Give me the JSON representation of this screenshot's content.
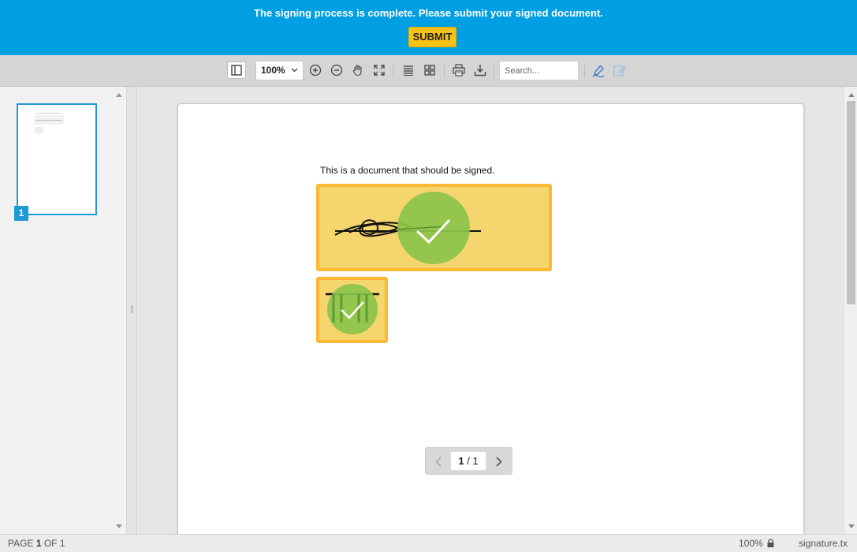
{
  "banner": {
    "message": "The signing process is complete. Please submit your signed document.",
    "submit_label": "SUBMIT"
  },
  "toolbar": {
    "zoom_value": "100%",
    "search_placeholder": "Search...",
    "icons": [
      "sidebar-toggle-icon",
      "zoom-in-icon",
      "zoom-out-icon",
      "pan-hand-icon",
      "fit-page-icon",
      "single-page-icon",
      "grid-view-icon",
      "print-icon",
      "download-icon",
      "signature-pen-icon",
      "edit-form-icon"
    ]
  },
  "sidebar": {
    "thumbnails": [
      {
        "number": "1"
      }
    ]
  },
  "document": {
    "text": "This is a document that should be signed.",
    "signature_fields": [
      {
        "type": "signature",
        "status": "signed"
      },
      {
        "type": "initials",
        "status": "signed"
      }
    ]
  },
  "pagination": {
    "current": "1",
    "separator": "/",
    "total": "1"
  },
  "status_bar": {
    "page_prefix": "PAGE",
    "page_current": "1",
    "page_of": "OF",
    "page_total": "1",
    "zoom": "100%",
    "filename": "signature.tx"
  },
  "colors": {
    "banner": "#009fe3",
    "submit": "#f7c213",
    "signature_fill": "#f5d56d",
    "signature_border": "#fbb937",
    "check_green": "#8bc34a",
    "accent": "#1e9ad6"
  }
}
